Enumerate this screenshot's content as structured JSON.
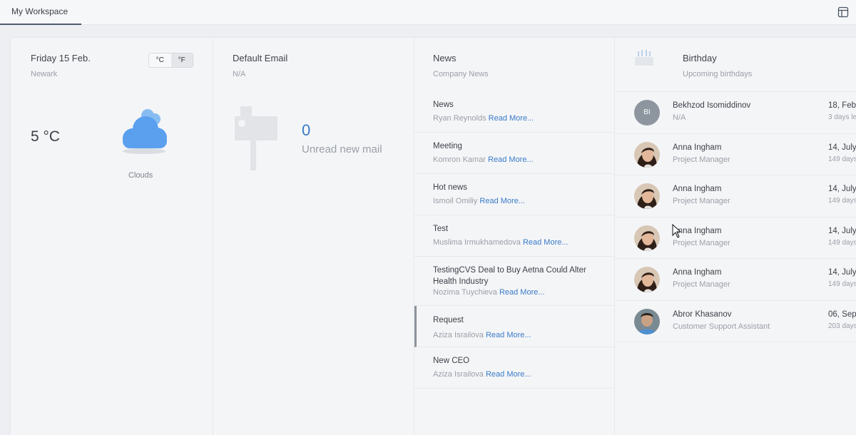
{
  "tabs": [
    {
      "label": "My Workspace",
      "active": true
    }
  ],
  "weather": {
    "date": "Friday 15 Feb.",
    "city": "Newark",
    "unit_c": "°C",
    "unit_f": "°F",
    "temperature": "5 °C",
    "condition": "Clouds",
    "icon": "cloud-icon"
  },
  "email": {
    "title": "Default Email",
    "address": "N/A",
    "unread_count": "0",
    "unread_label": "Unread new mail",
    "icon": "mailbox-icon"
  },
  "news": {
    "title": "News",
    "subtitle": "Company News",
    "read_more": "Read More...",
    "items": [
      {
        "title": "News",
        "author": "Ryan Reynolds"
      },
      {
        "title": "Meeting",
        "author": "Komron Kamar"
      },
      {
        "title": "Hot news",
        "author": "Ismoil Omiliy"
      },
      {
        "title": "Test",
        "author": "Muslima Irmukhamedova"
      },
      {
        "title": "TestingCVS Deal to Buy Aetna Could Alter Health Industry",
        "author": "Nozima Tuychieva"
      },
      {
        "title": "Request",
        "author": "Aziza Israilova",
        "selected": true
      },
      {
        "title": "New CEO",
        "author": "Aziza Israilova"
      }
    ]
  },
  "birthday": {
    "title": "Birthday",
    "subtitle": "Upcoming birthdays",
    "icon": "cake-icon",
    "items": [
      {
        "initials": "BI",
        "name": "Bekhzod Isomiddinov",
        "role": "N/A",
        "date": "18, Febr",
        "left": "3 days le"
      },
      {
        "avatar": "photo-woman",
        "name": "Anna Ingham",
        "role": "Project Manager",
        "date": "14, July",
        "left": "149 days"
      },
      {
        "avatar": "photo-woman",
        "name": "Anna Ingham",
        "role": "Project Manager",
        "date": "14, July",
        "left": "149 days"
      },
      {
        "avatar": "photo-woman",
        "name": "Anna Ingham",
        "role": "Project Manager",
        "date": "14, July",
        "left": "149 days"
      },
      {
        "avatar": "photo-woman",
        "name": "Anna Ingham",
        "role": "Project Manager",
        "date": "14, July",
        "left": "149 days"
      },
      {
        "avatar": "photo-man",
        "name": "Abror Khasanov",
        "role": "Customer Support Assistant",
        "date": "06, Sep",
        "left": "203 days"
      }
    ]
  },
  "colors": {
    "accent": "#3a7bc8",
    "cloud": "#5aa0ee"
  }
}
